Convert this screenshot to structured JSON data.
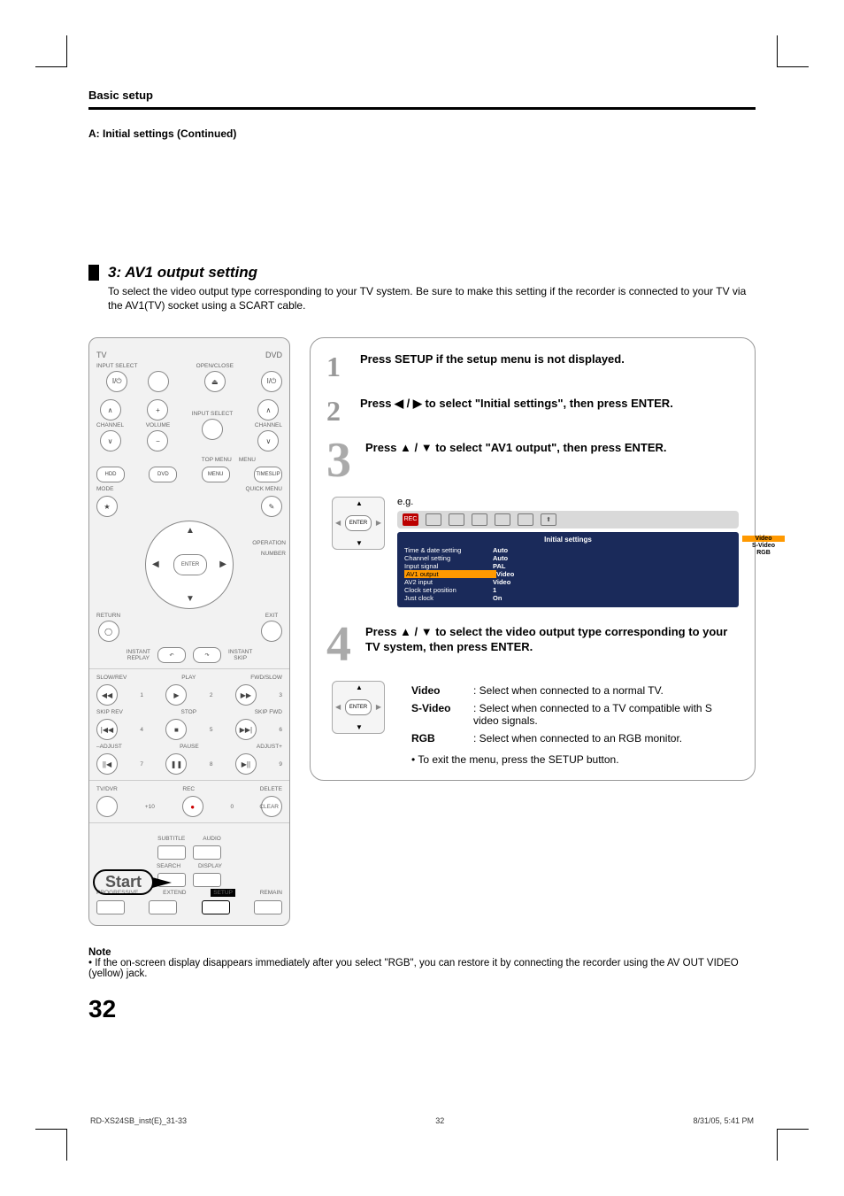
{
  "header": {
    "section": "Basic setup",
    "subsection": "A: Initial settings (Continued)"
  },
  "section": {
    "title": "3: AV1 output setting",
    "desc": "To select the video output type corresponding to your TV system. Be sure to make this setting if the recorder is connected to your TV via the AV1(TV) socket using a SCART cable."
  },
  "remote": {
    "tv": "TV",
    "dvd": "DVD",
    "input_select": "INPUT SELECT",
    "open_close": "OPEN/CLOSE",
    "channel": "CHANNEL",
    "volume": "VOLUME",
    "input_select2": "INPUT SELECT",
    "channel2": "CHANNEL",
    "top_menu": "TOP MENU",
    "menu": "MENU",
    "hdd": "HDD",
    "dvd_btn": "DVD",
    "menu_btn": "MENU",
    "timeslip": "TIMESLIP",
    "mode": "MODE",
    "quick_menu": "QUICK MENU",
    "operation": "OPERATION",
    "number": "NUMBER",
    "enter": "ENTER",
    "return": "RETURN",
    "exit": "EXIT",
    "instant_replay": "INSTANT\nREPLAY",
    "instant_skip": "INSTANT\nSKIP",
    "slow_rev": "SLOW/REV",
    "play": "PLAY",
    "fwd_slow": "FWD/SLOW",
    "skip_rev": "SKIP REV",
    "stop": "STOP",
    "skip_fwd": "SKIP FWD",
    "adjust_minus": "–ADJUST",
    "pause": "PAUSE",
    "adjust_plus": "ADJUST+",
    "tv_dvr": "TV/DVR",
    "rec": "REC",
    "delete": "DELETE",
    "clear": "CLEAR",
    "subtitle": "SUBTITLE",
    "audio": "AUDIO",
    "search": "SEARCH",
    "display": "DISPLAY",
    "progressive": "PROGRESSIVE",
    "extend": "EXTEND",
    "setup": "SETUP",
    "remain": "REMAIN",
    "start": "Start",
    "n1": "1",
    "n2": "2",
    "n3": "3",
    "n4": "4",
    "n5": "5",
    "n6": "6",
    "n7": "7",
    "n8": "8",
    "n9": "9",
    "n0": "0",
    "p10": "+10"
  },
  "steps": {
    "s1": "Press SETUP if the setup menu is not displayed.",
    "s2": "Press ◀ / ▶ to select \"Initial settings\", then press ENTER.",
    "s3": "Press ▲ / ▼ to select \"AV1 output\", then press ENTER.",
    "s4": "Press ▲ / ▼ to select the video output type corresponding to your TV system, then press ENTER.",
    "eg": "e.g.",
    "enter_label": "ENTER"
  },
  "osd": {
    "title": "Initial settings",
    "rows": [
      {
        "name": "Time & date setting",
        "value": "Auto"
      },
      {
        "name": "Channel setting",
        "value": "Auto"
      },
      {
        "name": "Input signal",
        "value": "PAL"
      },
      {
        "name": "AV1 output",
        "value": "Video",
        "highlight": true
      },
      {
        "name": "AV2 input",
        "value": "Video"
      },
      {
        "name": "Clock set position",
        "value": "1"
      },
      {
        "name": "Just clock",
        "value": "On"
      }
    ],
    "side": [
      "Video",
      "S-Video",
      "RGB"
    ]
  },
  "options": {
    "video": {
      "label": "Video",
      "desc": "Select when connected to a normal TV."
    },
    "svideo": {
      "label": "S-Video",
      "desc": "Select when connected to a TV compatible with S video signals."
    },
    "rgb": {
      "label": "RGB",
      "desc": "Select when connected to an RGB monitor."
    },
    "exit": "• To exit the menu, press the SETUP button."
  },
  "note": {
    "title": "Note",
    "body": "• If the on-screen display disappears immediately after you select \"RGB\", you can restore it by connecting the recorder using the  AV OUT VIDEO (yellow) jack."
  },
  "page_number": "32",
  "footer": {
    "left": "RD-XS24SB_inst(E)_31-33",
    "mid": "32",
    "right": "8/31/05, 5:41 PM"
  }
}
